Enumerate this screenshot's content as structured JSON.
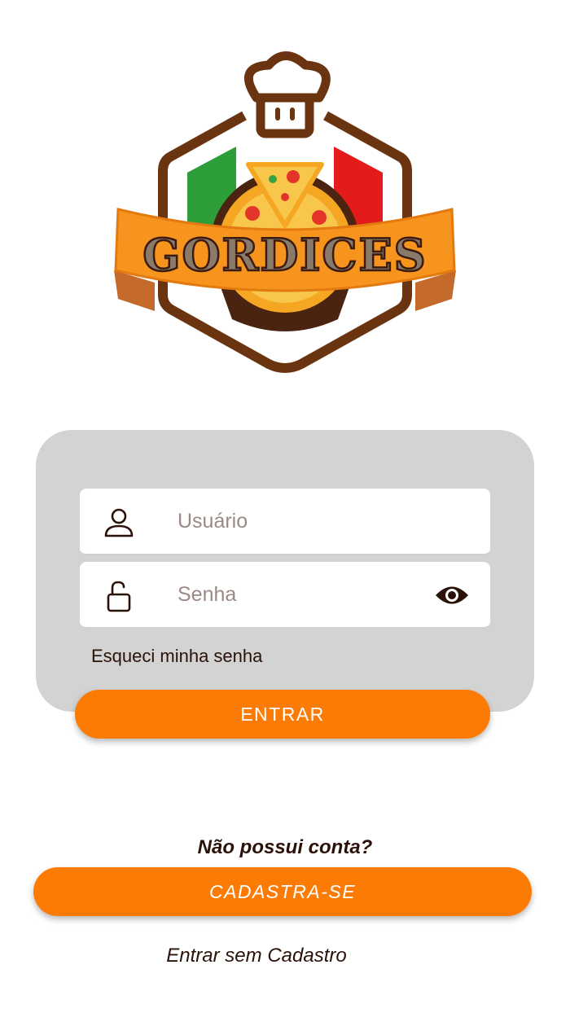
{
  "brand": {
    "name": "GORDICES"
  },
  "colors": {
    "accent": "#fc7b05",
    "card": "#d3d3d3",
    "text": "#2b1208",
    "logo_brown": "#6b3410",
    "logo_orange": "#f7941d"
  },
  "login": {
    "username": {
      "placeholder": "Usuário",
      "value": "",
      "icon": "user-icon"
    },
    "password": {
      "placeholder": "Senha",
      "value": "",
      "icon": "lock-open-icon",
      "toggle_icon": "eye-icon"
    },
    "forgot_label": "Esqueci minha senha",
    "enter_label": "ENTRAR"
  },
  "signup": {
    "prompt": "Não possui conta?",
    "button_label": "CADASTRA-SE"
  },
  "guest_label": "Entrar sem Cadastro"
}
